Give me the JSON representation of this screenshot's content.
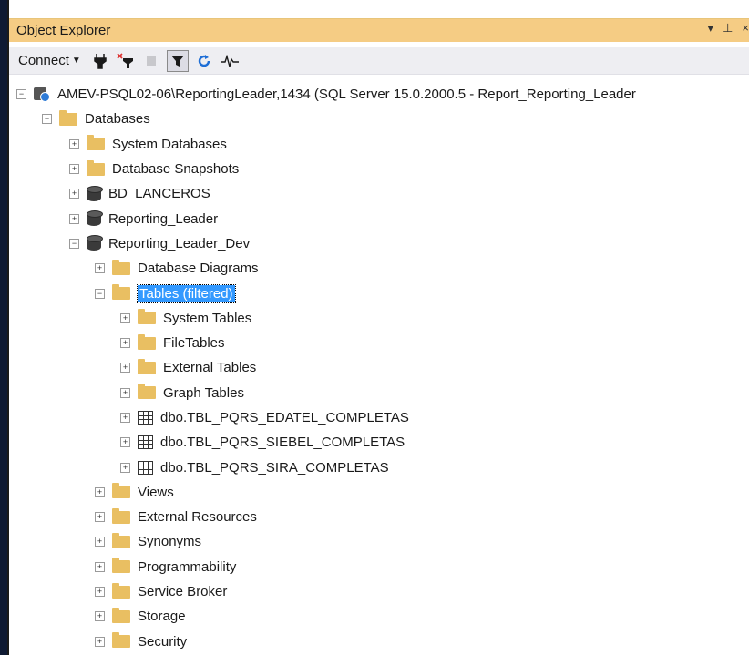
{
  "window": {
    "title": "Object Explorer",
    "title_buttons": [
      "▾",
      "⊥",
      "×"
    ]
  },
  "toolbar": {
    "connect_label": "Connect",
    "buttons": [
      "connect-icon",
      "disconnect-icon",
      "stop-icon",
      "filter-icon",
      "refresh-icon",
      "activity-monitor-icon"
    ]
  },
  "tree": {
    "server": "AMEV-PSQL02-06\\ReportingLeader,1434 (SQL Server 15.0.2000.5 - Report_Reporting_Leader",
    "databases": "Databases",
    "system_databases": "System Databases",
    "database_snapshots": "Database Snapshots",
    "db1": "BD_LANCEROS",
    "db2": "Reporting_Leader",
    "db3": "Reporting_Leader_Dev",
    "database_diagrams": "Database Diagrams",
    "tables": "Tables (filtered)",
    "system_tables": "System Tables",
    "file_tables": "FileTables",
    "external_tables": "External Tables",
    "graph_tables": "Graph Tables",
    "table1": "dbo.TBL_PQRS_EDATEL_COMPLETAS",
    "table2": "dbo.TBL_PQRS_SIEBEL_COMPLETAS",
    "table3": "dbo.TBL_PQRS_SIRA_COMPLETAS",
    "views": "Views",
    "external_resources": "External Resources",
    "synonyms": "Synonyms",
    "programmability": "Programmability",
    "service_broker": "Service Broker",
    "storage": "Storage",
    "security": "Security"
  },
  "colors": {
    "title_bar": "#f5cc84",
    "selection": "#3399ff",
    "folder": "#e9bf62"
  }
}
